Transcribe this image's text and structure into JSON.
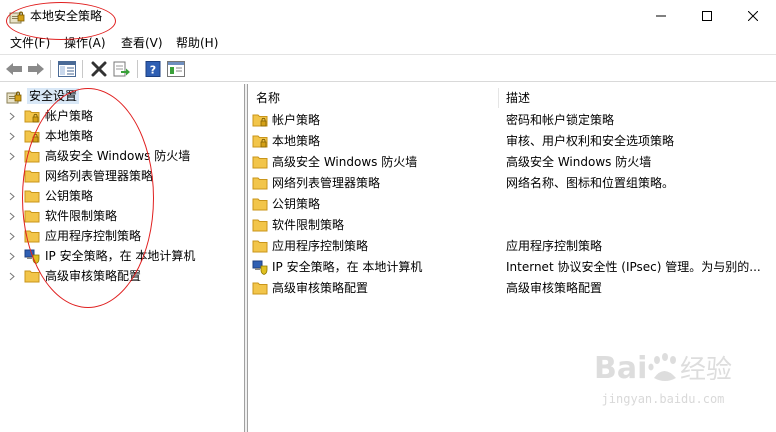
{
  "window": {
    "title": "本地安全策略",
    "icons": {
      "app": "security-policy-icon",
      "minimize": "minimize-icon",
      "maximize": "maximize-icon",
      "close": "close-icon"
    }
  },
  "menu": [
    {
      "label": "文件(F)"
    },
    {
      "label": "操作(A)"
    },
    {
      "label": "查看(V)"
    },
    {
      "label": "帮助(H)"
    }
  ],
  "toolbar": {
    "buttons": [
      "back-arrow-icon",
      "forward-arrow-icon",
      "show-tree-icon",
      "delete-icon",
      "export-list-icon",
      "help-icon",
      "properties-icon"
    ]
  },
  "tree": {
    "root": {
      "label": "安全设置",
      "icon": "security-settings-icon"
    },
    "items": [
      {
        "label": "帐户策略",
        "icon": "folder-lock-icon"
      },
      {
        "label": "本地策略",
        "icon": "folder-lock-icon"
      },
      {
        "label": "高级安全 Windows 防火墙",
        "icon": "folder-icon"
      },
      {
        "label": "网络列表管理器策略",
        "icon": "folder-icon"
      },
      {
        "label": "公钥策略",
        "icon": "folder-icon"
      },
      {
        "label": "软件限制策略",
        "icon": "folder-icon"
      },
      {
        "label": "应用程序控制策略",
        "icon": "folder-icon"
      },
      {
        "label": "IP 安全策略，在 本地计算机",
        "icon": "ip-security-icon"
      },
      {
        "label": "高级审核策略配置",
        "icon": "folder-icon"
      }
    ]
  },
  "list": {
    "columns": {
      "name": "名称",
      "desc": "描述"
    },
    "rows": [
      {
        "name": "帐户策略",
        "desc": "密码和帐户锁定策略",
        "icon": "folder-lock-icon"
      },
      {
        "name": "本地策略",
        "desc": "审核、用户权利和安全选项策略",
        "icon": "folder-lock-icon"
      },
      {
        "name": "高级安全 Windows 防火墙",
        "desc": "高级安全 Windows 防火墙",
        "icon": "folder-icon"
      },
      {
        "name": "网络列表管理器策略",
        "desc": "网络名称、图标和位置组策略。",
        "icon": "folder-icon"
      },
      {
        "name": "公钥策略",
        "desc": "",
        "icon": "folder-icon"
      },
      {
        "name": "软件限制策略",
        "desc": "",
        "icon": "folder-icon"
      },
      {
        "name": "应用程序控制策略",
        "desc": "应用程序控制策略",
        "icon": "folder-icon"
      },
      {
        "name": "IP 安全策略，在 本地计算机",
        "desc": "Internet 协议安全性 (IPsec) 管理。为与别的...",
        "icon": "ip-security-icon"
      },
      {
        "name": "高级审核策略配置",
        "desc": "高级审核策略配置",
        "icon": "folder-icon"
      }
    ]
  },
  "watermark": {
    "url": "jingyan.baidu.com"
  },
  "colors": {
    "selection": "#d9e8f7",
    "folder": "#f2c54a",
    "annotation": "#e02020"
  }
}
